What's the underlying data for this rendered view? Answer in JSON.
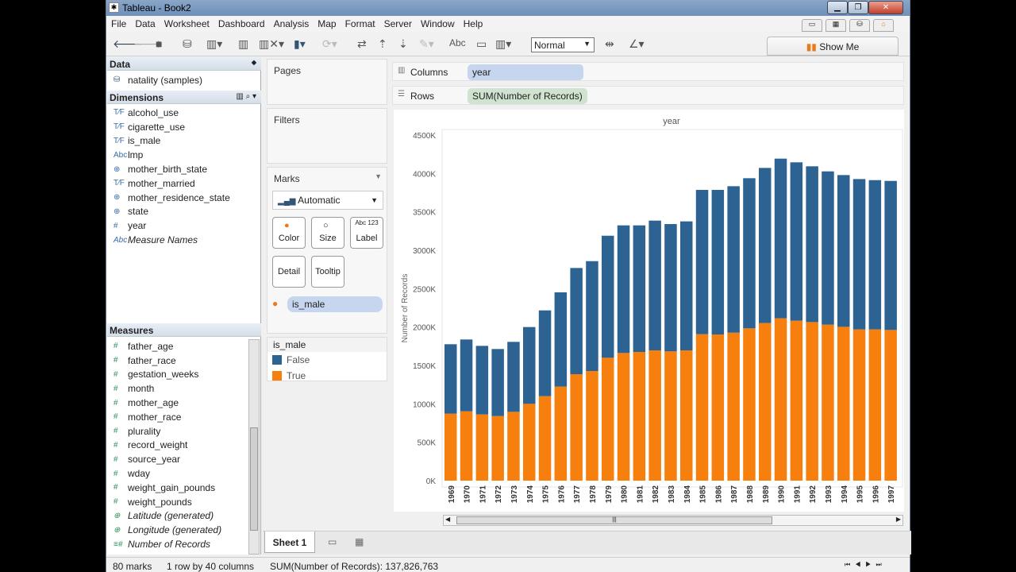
{
  "window": {
    "title": "Tableau - Book2",
    "icon": "tableau-icon"
  },
  "menu": [
    "File",
    "Data",
    "Worksheet",
    "Dashboard",
    "Analysis",
    "Map",
    "Format",
    "Server",
    "Window",
    "Help"
  ],
  "toolbar": {
    "fit_select": "Normal",
    "show_me": "Show Me"
  },
  "data_pane": {
    "header": "Data",
    "datasource": "natality (samples)",
    "dimensions_header": "Dimensions",
    "measures_header": "Measures",
    "dimensions": [
      {
        "icon": "T/F",
        "label": "alcohol_use"
      },
      {
        "icon": "T/F",
        "label": "cigarette_use"
      },
      {
        "icon": "T/F",
        "label": "is_male"
      },
      {
        "icon": "Abc",
        "label": "lmp"
      },
      {
        "icon": "globe",
        "label": "mother_birth_state"
      },
      {
        "icon": "T/F",
        "label": "mother_married"
      },
      {
        "icon": "globe",
        "label": "mother_residence_state"
      },
      {
        "icon": "globe",
        "label": "state"
      },
      {
        "icon": "#",
        "label": "year"
      },
      {
        "icon": "Abc",
        "label": "Measure Names",
        "italic": true
      }
    ],
    "measures": [
      {
        "icon": "#",
        "label": "father_age"
      },
      {
        "icon": "#",
        "label": "father_race"
      },
      {
        "icon": "#",
        "label": "gestation_weeks"
      },
      {
        "icon": "#",
        "label": "month"
      },
      {
        "icon": "#",
        "label": "mother_age"
      },
      {
        "icon": "#",
        "label": "mother_race"
      },
      {
        "icon": "#",
        "label": "plurality"
      },
      {
        "icon": "#",
        "label": "record_weight"
      },
      {
        "icon": "#",
        "label": "source_year"
      },
      {
        "icon": "#",
        "label": "wday"
      },
      {
        "icon": "#",
        "label": "weight_gain_pounds"
      },
      {
        "icon": "#",
        "label": "weight_pounds"
      },
      {
        "icon": "globe",
        "label": "Latitude (generated)",
        "italic": true
      },
      {
        "icon": "globe",
        "label": "Longitude (generated)",
        "italic": true
      },
      {
        "icon": "=#",
        "label": "Number of Records",
        "italic": true
      }
    ]
  },
  "pages": {
    "label": "Pages"
  },
  "filters": {
    "label": "Filters"
  },
  "marks": {
    "label": "Marks",
    "type": "Automatic",
    "buttons": [
      "Color",
      "Size",
      "Label",
      "Detail",
      "Tooltip"
    ],
    "label_icon": "Abc 123",
    "color_field": "is_male"
  },
  "legend": {
    "title": "is_male",
    "items": [
      {
        "label": "False",
        "color": "#2c6392"
      },
      {
        "label": "True",
        "color": "#f77f0e"
      }
    ]
  },
  "shelves": {
    "columns_label": "Columns",
    "columns_pill": "year",
    "rows_label": "Rows",
    "rows_pill": "SUM(Number of Records)"
  },
  "tabs": {
    "sheet": "Sheet 1"
  },
  "status": {
    "marks": "80 marks",
    "dims": "1 row by 40 columns",
    "sum": "SUM(Number of Records): 137,826,763"
  },
  "chart_data": {
    "type": "bar",
    "stacked": true,
    "title": "year",
    "xlabel": "year",
    "ylabel": "Number of Records",
    "ylim": [
      0,
      4500000
    ],
    "yticks": [
      "0K",
      "500K",
      "1000K",
      "1500K",
      "2000K",
      "2500K",
      "3000K",
      "3500K",
      "4000K",
      "4500K"
    ],
    "categories": [
      "1969",
      "1970",
      "1971",
      "1972",
      "1973",
      "1974",
      "1975",
      "1976",
      "1977",
      "1978",
      "1979",
      "1980",
      "1981",
      "1982",
      "1983",
      "1984",
      "1985",
      "1986",
      "1987",
      "1988",
      "1989",
      "1990",
      "1991",
      "1992",
      "1993",
      "1994",
      "1995",
      "1996",
      "1997"
    ],
    "series": [
      {
        "name": "True",
        "color": "#f77f0e",
        "values": [
          872000,
          903000,
          862000,
          841000,
          896000,
          1000000,
          1100000,
          1224000,
          1386000,
          1427000,
          1600000,
          1662000,
          1676000,
          1696000,
          1683000,
          1696000,
          1907000,
          1903000,
          1927000,
          1983000,
          2052000,
          2114000,
          2083000,
          2065000,
          2031000,
          2003000,
          1969000,
          1969000,
          1962000
        ]
      },
      {
        "name": "False",
        "color": "#2c6392",
        "values": [
          904000,
          935000,
          893000,
          873000,
          911000,
          1000000,
          1117000,
          1228000,
          1383000,
          1431000,
          1589000,
          1662000,
          1648000,
          1690000,
          1658000,
          1680000,
          1879000,
          1883000,
          1907000,
          1955000,
          2020000,
          2079000,
          2062000,
          2028000,
          1996000,
          1976000,
          1958000,
          1944000,
          1941000
        ]
      }
    ],
    "grid": false,
    "legend": "right-panel"
  }
}
